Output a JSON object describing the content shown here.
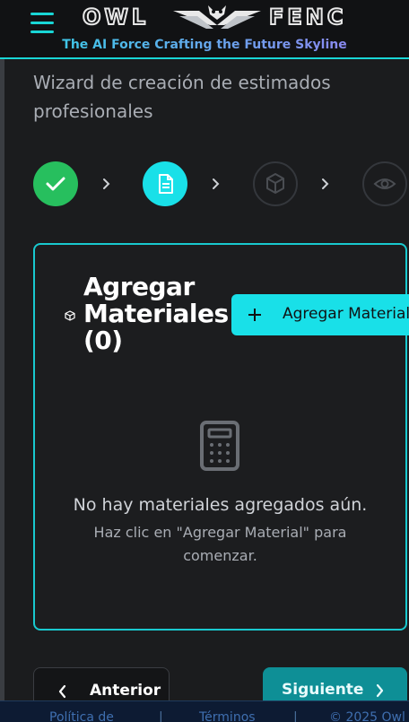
{
  "header": {
    "brand_left": "OWL",
    "brand_right": "FENC",
    "tagline": "The AI Force Crafting the Future Skyline",
    "menu_icon": "hamburger-menu-icon"
  },
  "wizard": {
    "subtitle": "Wizard de creación de estimados profesionales",
    "steps": [
      {
        "icon": "check-icon",
        "state": "completed"
      },
      {
        "icon": "document-icon",
        "state": "active"
      },
      {
        "icon": "cube-icon",
        "state": "pending"
      },
      {
        "icon": "eye-icon",
        "state": "pending"
      }
    ]
  },
  "materials": {
    "title": "Agregar Materiales (0)",
    "add_button": "Agregar Material",
    "empty_title": "No hay materiales agregados aún.",
    "empty_hint": "Haz clic en \"Agregar Material\" para comenzar."
  },
  "navigation": {
    "prev": "Anterior",
    "next": "Siguiente"
  },
  "footer": {
    "privacy": "Política de",
    "terms": "Términos",
    "copyright": "© 2025 Owl"
  },
  "colors": {
    "accent": "#19e0e8",
    "success": "#27bf5e",
    "background": "#1b1c1e"
  }
}
